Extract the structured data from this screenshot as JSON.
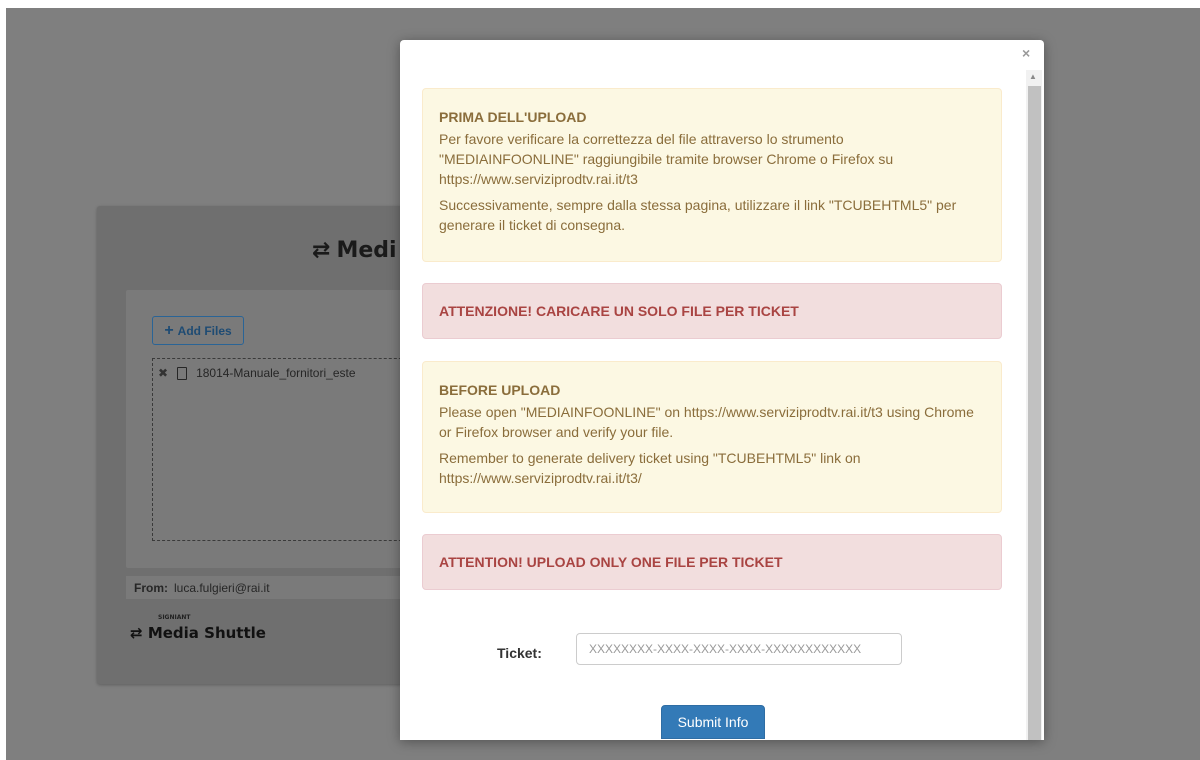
{
  "background_app": {
    "title": "Medi",
    "add_files_label": "Add Files",
    "file_name": "18014-Manuale_fornitori_este",
    "from_label": "From:",
    "from_value": "luca.fulgieri@rai.it",
    "brand_small": "SIGNIANT",
    "brand_name": "Media Shuttle"
  },
  "modal": {
    "close_label": "×",
    "alerts": [
      {
        "type": "warning",
        "heading": "PRIMA DELL'UPLOAD",
        "paragraphs": [
          "Per favore verificare la correttezza del file attraverso lo strumento \"MEDIAINFOONLINE\" raggiungibile tramite browser Chrome o Firefox su https://www.serviziprodtv.rai.it/t3",
          "Successivamente, sempre dalla stessa pagina, utilizzare il link \"TCUBEHTML5\" per generare il ticket di consegna."
        ]
      },
      {
        "type": "danger",
        "message": "ATTENZIONE! CARICARE UN SOLO FILE PER TICKET"
      },
      {
        "type": "warning",
        "heading": "BEFORE UPLOAD",
        "paragraphs": [
          "Please open \"MEDIAINFOONLINE\" on https://www.serviziprodtv.rai.it/t3 using Chrome or Firefox browser and verify your file.",
          "Remember to generate delivery ticket using \"TCUBEHTML5\" link on https://www.serviziprodtv.rai.it/t3/"
        ]
      },
      {
        "type": "danger",
        "message": "ATTENTION! UPLOAD ONLY ONE FILE PER TICKET"
      }
    ],
    "ticket_label": "Ticket:",
    "ticket_placeholder": "XXXXXXXX-XXXX-XXXX-XXXX-XXXXXXXXXXXX",
    "ticket_value": "",
    "submit_label": "Submit Info"
  },
  "colors": {
    "primary": "#337ab7",
    "warning_bg": "#fcf8e3",
    "warning_text": "#8a6d3b",
    "danger_bg": "#f2dede",
    "danger_text": "#a94442"
  }
}
